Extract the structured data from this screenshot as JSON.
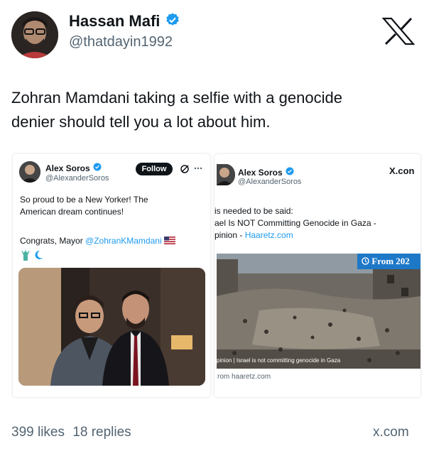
{
  "header": {
    "author_name": "Hassan Mafi",
    "author_handle": "@thatdayin1992",
    "logo_icon": "x-logo-icon"
  },
  "tweet": {
    "text_line1": "Zohran Mamdani taking a selfie with a genocide",
    "text_line2": "denier should tell you a lot about him."
  },
  "left_card": {
    "author_name": "Alex Soros",
    "author_handle": "@AlexanderSoros",
    "follow_label": "Follow",
    "text_line1": "So proud to be a New Yorker! The",
    "text_line2": "American dream continues!",
    "congrats_prefix": "Congrats, Mayor ",
    "mention": "@ZohranKMamdani",
    "flag_emoji": "🇺🇸"
  },
  "right_card": {
    "author_name": "Alex Soros",
    "author_handle": "@AlexanderSoros",
    "site_label": "X.con",
    "text_line1": "is needed to be said:",
    "text_line2": "ael Is NOT Committing Genocide in Gaza -",
    "opinion_prefix": "pinion - ",
    "haaretz_link": "Haaretz.com",
    "image_badge": "From 202",
    "image_caption": "pinion | Israel is not committing genocide in Gaza",
    "from_label": "rom haaretz.com"
  },
  "footer": {
    "likes": "399 likes",
    "replies": "18 replies",
    "domain": "x.com"
  },
  "colors": {
    "verified_blue": "#1d9bf0",
    "text_primary": "#0f1419",
    "text_secondary": "#536471"
  }
}
